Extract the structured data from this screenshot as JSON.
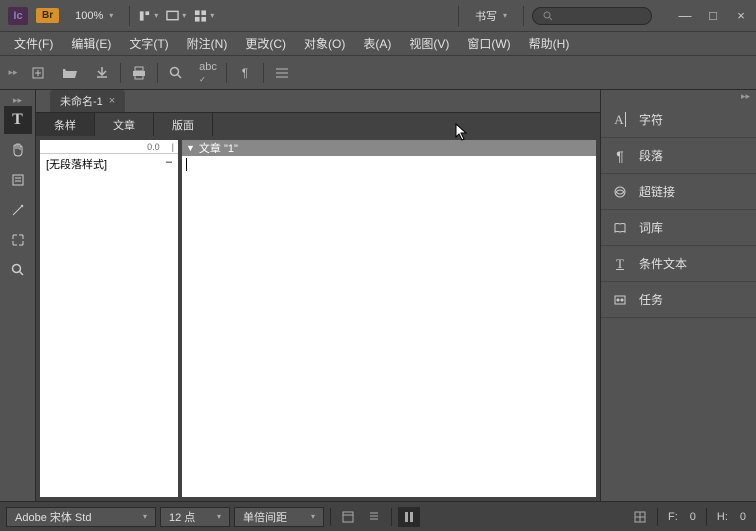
{
  "titlebar": {
    "app": "Ic",
    "badge": "Br",
    "zoom": "100%",
    "workspace": "书写",
    "search_placeholder": ""
  },
  "menus": [
    {
      "label": "文件(F)"
    },
    {
      "label": "编辑(E)"
    },
    {
      "label": "文字(T)"
    },
    {
      "label": "附注(N)"
    },
    {
      "label": "更改(C)"
    },
    {
      "label": "对象(O)"
    },
    {
      "label": "表(A)"
    },
    {
      "label": "视图(V)"
    },
    {
      "label": "窗口(W)"
    },
    {
      "label": "帮助(H)"
    }
  ],
  "doc_tab": {
    "name": "未命名-1",
    "dirty": "×"
  },
  "panel_tabs": [
    {
      "label": "条样",
      "active": true
    },
    {
      "label": "文章",
      "active": false
    },
    {
      "label": "版面",
      "active": false
    }
  ],
  "style_panel": {
    "ruler_val": "0.0",
    "items": [
      {
        "name": "[无段落样式]",
        "mark": "–"
      }
    ]
  },
  "editor": {
    "title": "文章 \"1\""
  },
  "right_panels": [
    {
      "icon": "A|",
      "label": "字符"
    },
    {
      "icon": "¶",
      "label": "段落"
    },
    {
      "icon": "link",
      "label": "超链接"
    },
    {
      "icon": "book",
      "label": "词库"
    },
    {
      "icon": "T",
      "label": "条件文本"
    },
    {
      "icon": "task",
      "label": "任务"
    }
  ],
  "bottombar": {
    "font": "Adobe 宋体 Std",
    "size": "12 点",
    "spacing": "单倍间距",
    "f_label": "F:",
    "f_val": "0",
    "h_label": "H:",
    "h_val": "0"
  }
}
